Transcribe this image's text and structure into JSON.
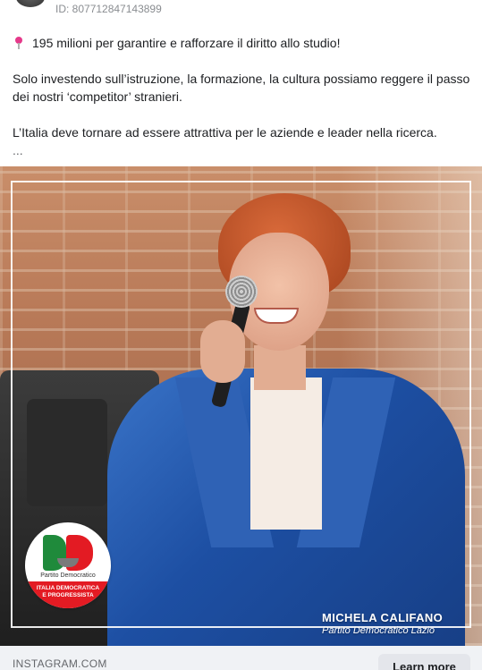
{
  "header": {
    "ad_id": "ID: 807712847143899",
    "avatar_alt": ""
  },
  "post": {
    "line_1": "195 milioni per garantire e rafforzare il diritto allo studio!",
    "line_1_icon": "pushpin-icon",
    "paragraph_2": "Solo investendo sull’istruzione, la formazione, la cultura possiamo reggere il passo dei nostri ‘competitor’ stranieri.",
    "paragraph_3": "L’Italia deve tornare ad essere attrattiva per le aziende e leader nella ricerca.",
    "ellipsis": "..."
  },
  "image": {
    "logo": {
      "name": "Partito Democratico",
      "band_text": "ITALIA DEMOCRATICA E PROGRESSISTA"
    },
    "caption_name": "MICHELA CALIFANO",
    "caption_party": "Partito Democratico Lazio"
  },
  "link_bar": {
    "domain": "INSTAGRAM.COM",
    "cta_label": "Learn more"
  },
  "colors": {
    "accent_pin": "#e5398a",
    "pd_green": "#1f8a3b",
    "pd_red": "#e31b23",
    "jacket_blue": "#1d4fa3"
  }
}
